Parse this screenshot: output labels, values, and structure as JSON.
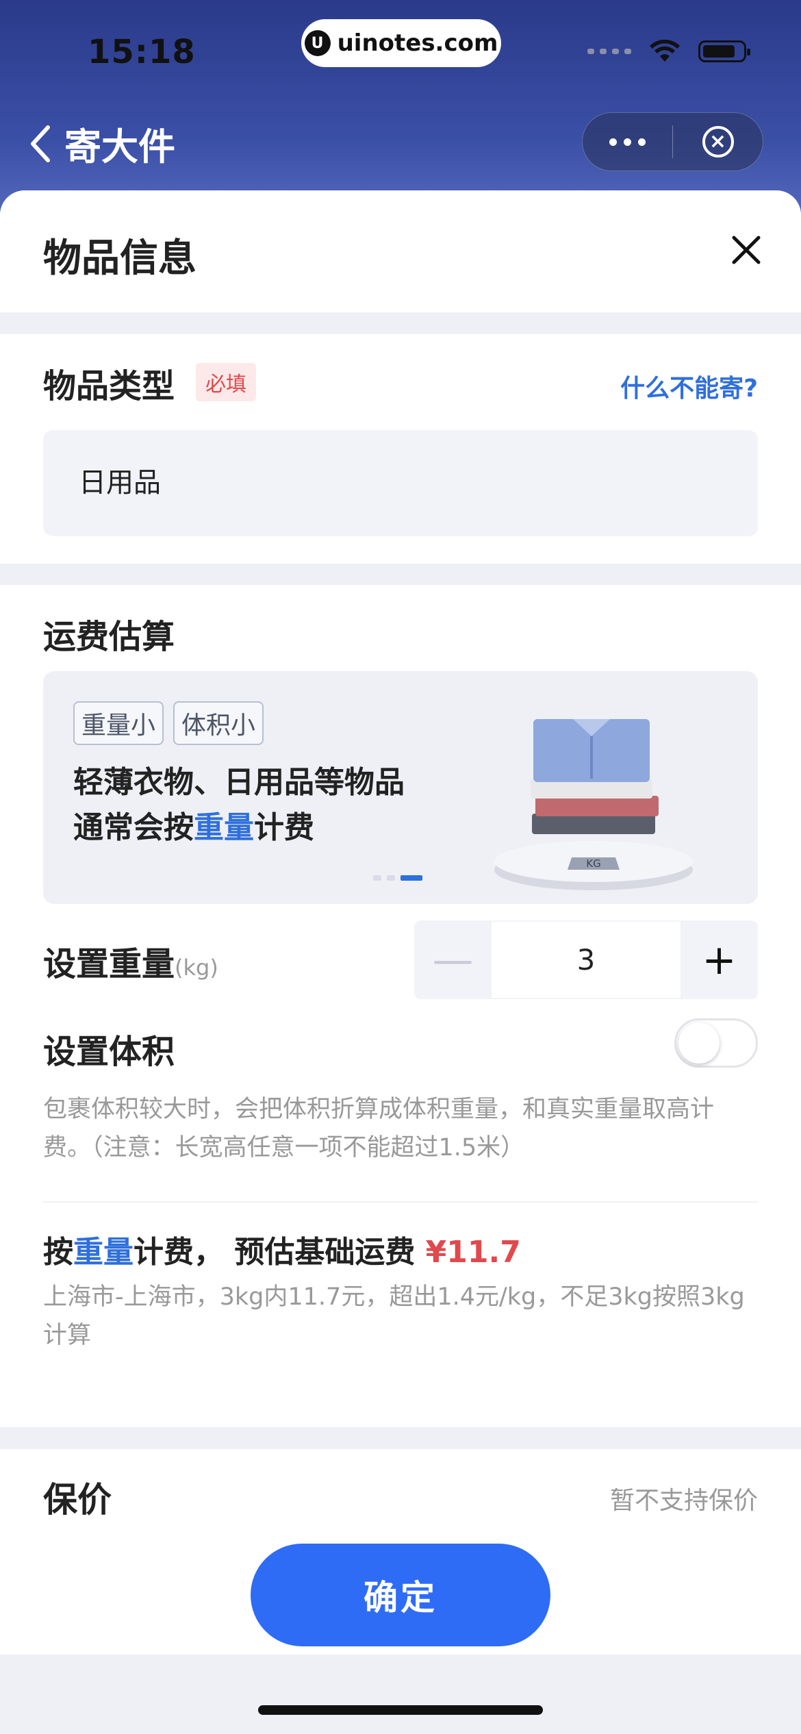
{
  "status_bar": {
    "time": "15:18"
  },
  "url_pill": {
    "logo": "U",
    "domain": "uinotes.com"
  },
  "nav": {
    "back_label": "寄大件"
  },
  "sheet": {
    "title": "物品信息"
  },
  "item_type": {
    "label": "物品类型",
    "required_badge": "必填",
    "help_link": "什么不能寄?",
    "value": "日用品"
  },
  "fee_estimate": {
    "title": "运费估算",
    "banner": {
      "tags": [
        "重量小",
        "体积小"
      ],
      "line1": "轻薄衣物、日用品等物品",
      "line2_prefix": "通常会按",
      "line2_highlight": "重量",
      "line2_suffix": "计费",
      "scale_label": "KG",
      "pager": {
        "count": 3,
        "active_index": 2
      }
    },
    "weight": {
      "label": "设置重量",
      "unit": "(kg)",
      "value": "3",
      "minus": "—",
      "plus": "+"
    },
    "volume": {
      "label": "设置体积",
      "enabled": false,
      "description": "包裹体积较大时，会把体积折算成体积重量，和真实重量取高计费。（注意：长宽高任意一项不能超过1.5米）"
    },
    "estimate": {
      "prefix": "按",
      "highlight": "重量",
      "middle": "计费，  预估基础运费 ",
      "price": "¥11.7",
      "detail": "上海市-上海市，3kg内11.7元，超出1.4元/kg，不足3kg按照3kg计算"
    }
  },
  "insurance": {
    "label": "保价",
    "note": "暂不支持保价"
  },
  "confirm_button": {
    "label": "确定"
  },
  "colors": {
    "accent": "#2e6cf6",
    "link": "#2f6fdc",
    "price": "#e0494d",
    "header": "#2b3a8a"
  }
}
